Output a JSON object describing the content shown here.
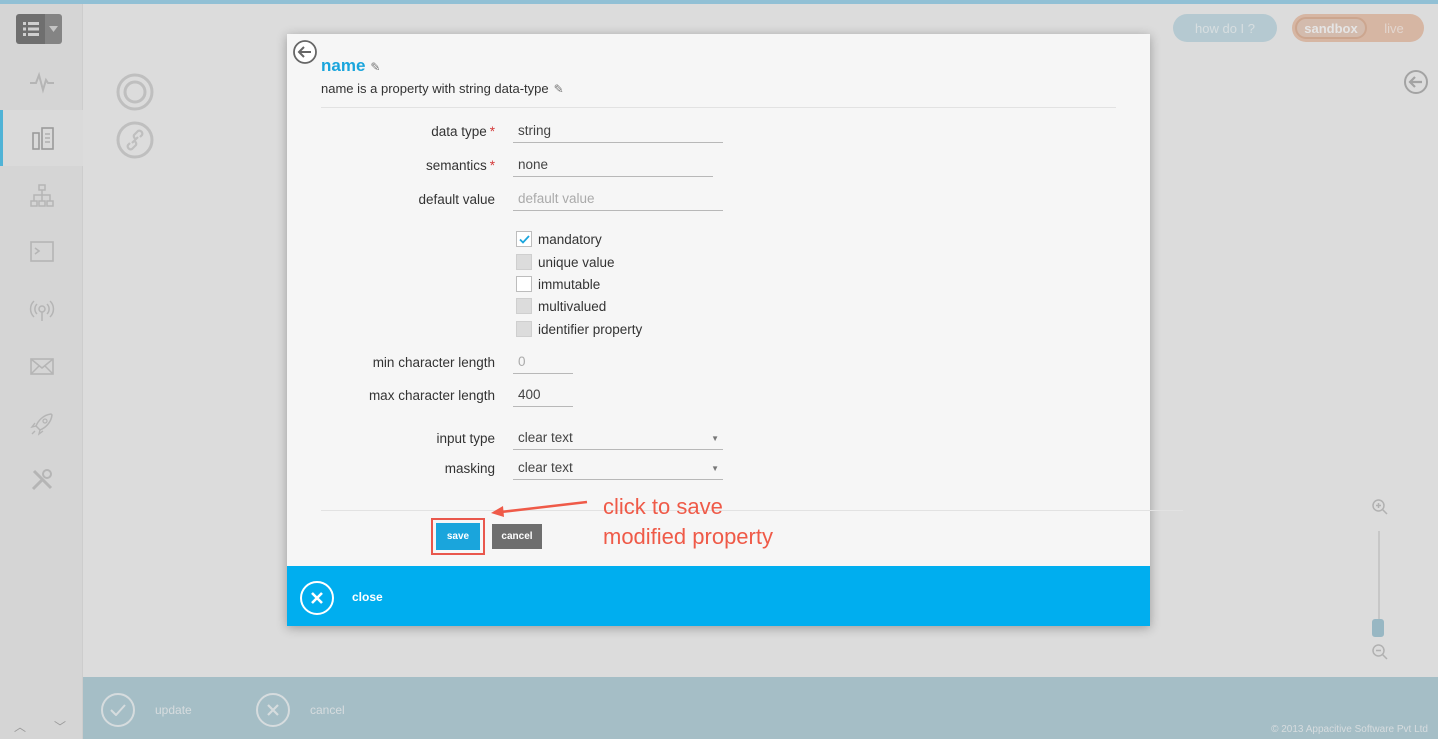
{
  "header": {
    "how_do_i": "how do I ?",
    "env_sandbox": "sandbox",
    "env_live": "live"
  },
  "bottom_bar": {
    "update_label": "update",
    "cancel_label": "cancel",
    "copyright": "© 2013 Appacitive Software Pvt Ltd"
  },
  "modal": {
    "property_name": "name",
    "description": "name is a property with string data-type",
    "fields": {
      "data_type_label": "data type",
      "data_type_value": "string",
      "semantics_label": "semantics",
      "semantics_value": "none",
      "default_value_label": "default value",
      "default_value_placeholder": "default value",
      "min_length_label": "min character length",
      "min_length_placeholder": "0",
      "max_length_label": "max character length",
      "max_length_value": "400",
      "input_type_label": "input type",
      "input_type_value": "clear text",
      "masking_label": "masking",
      "masking_value": "clear text"
    },
    "checkboxes": [
      {
        "label": "mandatory",
        "checked": true,
        "disabled": false
      },
      {
        "label": "unique value",
        "checked": false,
        "disabled": true
      },
      {
        "label": "immutable",
        "checked": false,
        "disabled": false
      },
      {
        "label": "multivalued",
        "checked": false,
        "disabled": true
      },
      {
        "label": "identifier property",
        "checked": false,
        "disabled": true
      }
    ],
    "save_label": "save",
    "cancel_label": "cancel",
    "close_label": "close"
  },
  "annotation": {
    "line1": "click to save",
    "line2": "modified property"
  },
  "colors": {
    "accent": "#00aeef",
    "annotation": "#ef5a48"
  }
}
